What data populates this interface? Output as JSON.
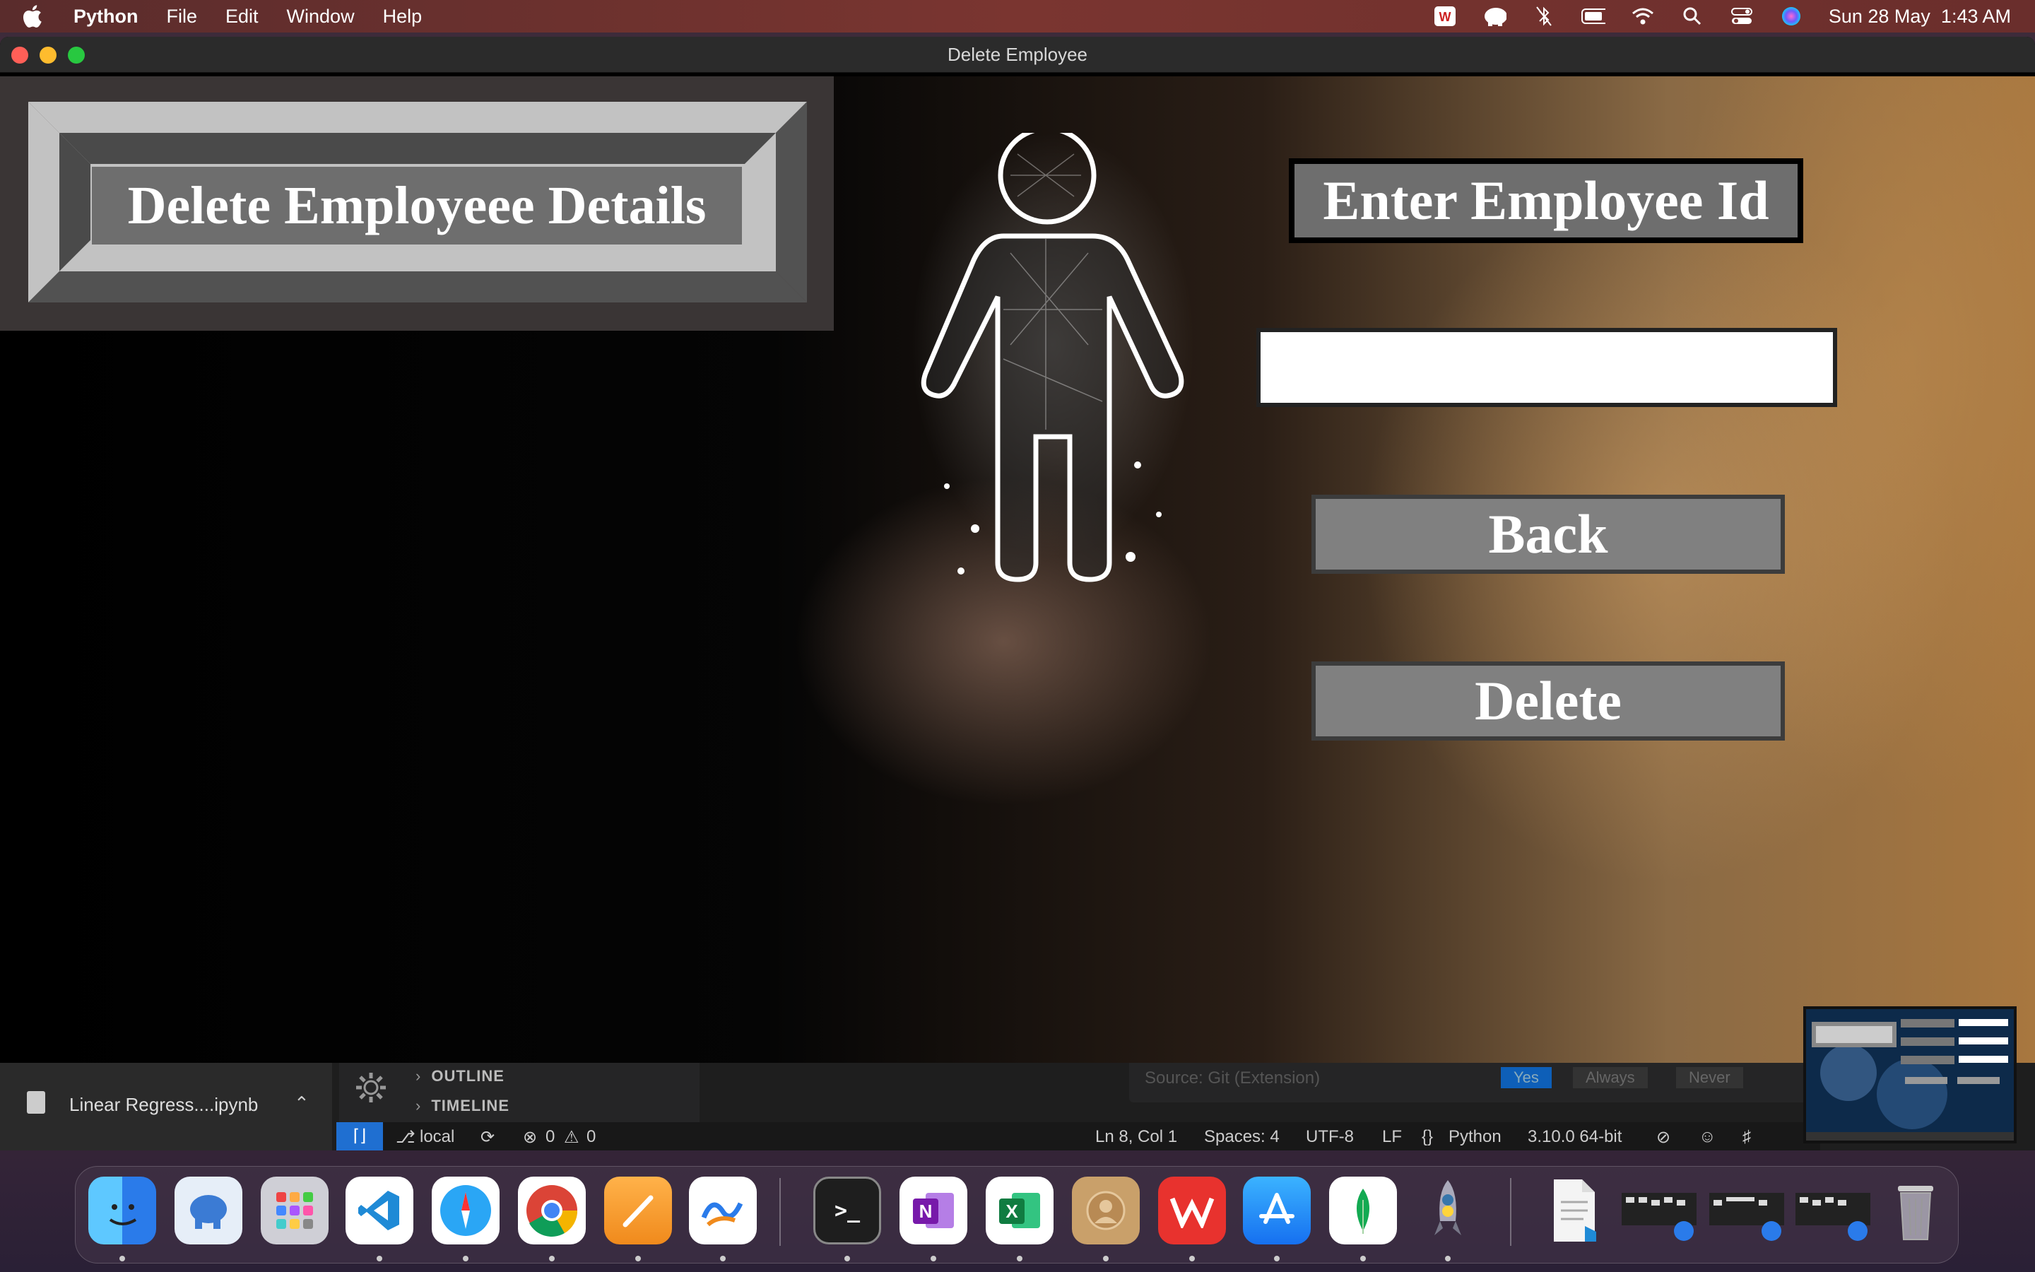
{
  "menubar": {
    "app_name": "Python",
    "menus": [
      "File",
      "Edit",
      "Window",
      "Help"
    ],
    "datetime": "Sun 28 May  1:43 AM",
    "status_icons": [
      "wps-icon",
      "tableplus-elephant-icon",
      "bluetooth-off-icon",
      "battery-icon",
      "wifi-icon",
      "spotlight-search-icon",
      "control-center-icon",
      "siri-icon"
    ]
  },
  "window": {
    "title": "Delete Employee"
  },
  "form": {
    "heading": "Delete Employeee Details",
    "id_label": "Enter Employee Id",
    "id_value": "",
    "back_label": "Back",
    "delete_label": "Delete"
  },
  "vscode": {
    "open_file": "Linear Regress....ipynb",
    "sections": [
      "OUTLINE",
      "TIMELINE"
    ],
    "notification": {
      "source": "Source: Git (Extension)",
      "buttons": [
        "Yes",
        "Always",
        "Never"
      ]
    },
    "status": {
      "branch": "local",
      "errors": "0",
      "warnings": "0",
      "position": "Ln 8, Col 1",
      "spaces": "Spaces: 4",
      "encoding": "UTF-8",
      "eol": "LF",
      "language": "Python",
      "interpreter": "3.10.0 64-bit"
    }
  },
  "dock": {
    "apps": [
      "finder-icon",
      "tableplus-icon",
      "launchpad-icon",
      "vscode-icon",
      "safari-icon",
      "chrome-icon",
      "pages-icon",
      "freeform-icon",
      "terminal-icon",
      "onenote-icon",
      "excel-icon",
      "contacts-icon",
      "wps-office-icon",
      "app-store-icon",
      "mongodb-icon",
      "python-launcher-icon",
      "document-icon",
      "window-thumb-1",
      "window-thumb-2",
      "window-thumb-3",
      "trash-icon"
    ]
  },
  "colors": {
    "accent_blue": "#1f6fd1",
    "label_grey": "#6e6e6e",
    "button_grey": "#808080"
  }
}
